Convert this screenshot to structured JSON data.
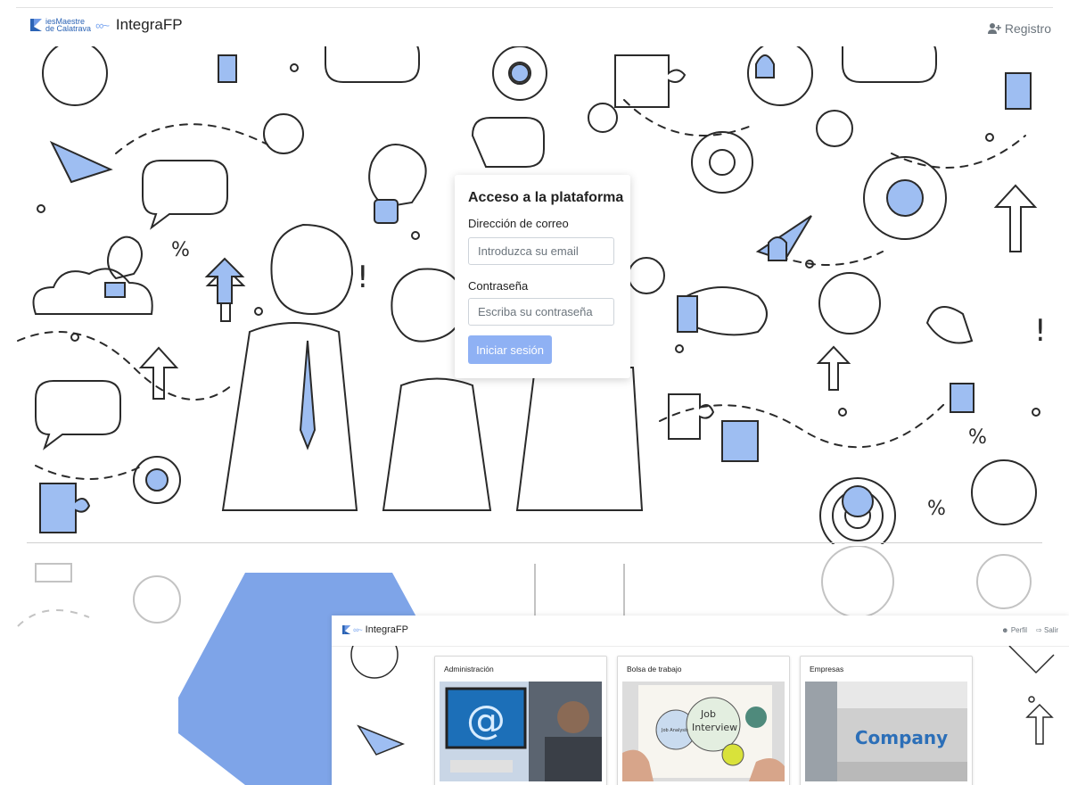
{
  "nav": {
    "logo_text_1": "iesMaestre",
    "logo_text_2": "de Calatrava",
    "app_name": "IntegraFP",
    "register_label": "Registro"
  },
  "login": {
    "title": "Acceso a la plataforma",
    "email_label": "Dirección de correo",
    "email_placeholder": "Introduzca su email",
    "password_label": "Contraseña",
    "password_placeholder": "Escriba su contraseña",
    "submit_label": "Iniciar sesión"
  },
  "preview": {
    "app_name": "IntegraFP",
    "profile_label": "Perfil",
    "logout_label": "Salir",
    "cards": [
      {
        "title": "Administración"
      },
      {
        "title": "Bolsa de trabajo",
        "image_text_1": "Job",
        "image_text_2": "Interview",
        "image_text_3": "Job Analysis"
      },
      {
        "title": "Empresas",
        "image_text": "Company"
      }
    ]
  },
  "colors": {
    "accent": "#8fb1f4",
    "illustration_blue": "#9ebef2",
    "ink": "#2a2a2a",
    "logo_blue": "#2b63b5"
  }
}
